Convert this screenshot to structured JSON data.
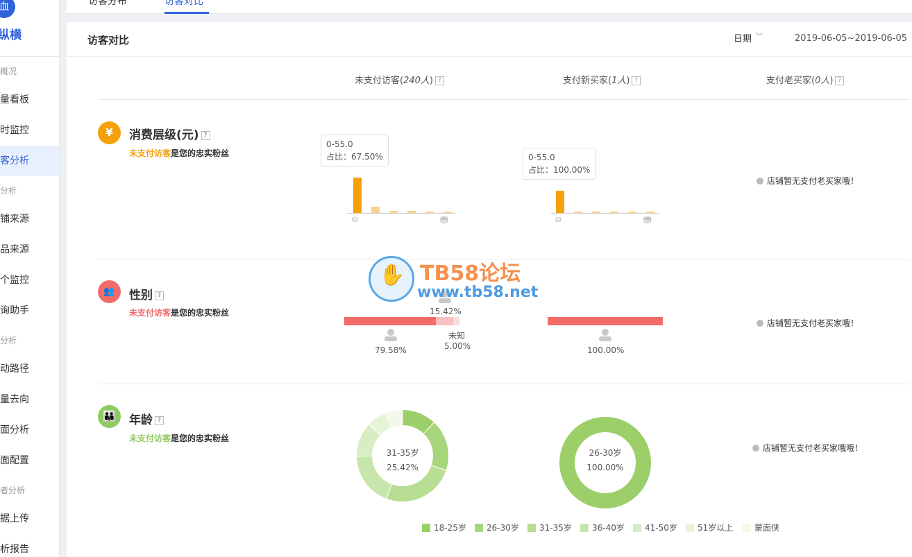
{
  "sidebar": {
    "logo_icon": "血",
    "logo_text": "量纵横",
    "groups": [
      "概况",
      "分析",
      "分析",
      "者分析"
    ],
    "items": [
      "量看板",
      "时监控",
      "客分析",
      "铺来源",
      "品来源",
      "个监控",
      "询助手",
      "动路径",
      "量去向",
      "面分析",
      "面配置",
      "据上传",
      "析报告"
    ]
  },
  "tabs": [
    "访客分布",
    "访客对比"
  ],
  "panel": {
    "title": "访客对比",
    "date_label": "日期",
    "date_range": "2019-06-05~2019-06-05",
    "columns": [
      {
        "label": "未支付访客(",
        "count": "240人",
        "close": ")"
      },
      {
        "label": "支付新买家(",
        "count": "1人",
        "close": ")"
      },
      {
        "label": "支付老买家(",
        "count": "0人",
        "close": ")"
      }
    ],
    "help_glyph": "?"
  },
  "sections": {
    "spend": {
      "icon_glyph": "¥",
      "title": "消费层级(元)",
      "highlight": "未支付访客",
      "subtitle_rest": "是您的忠实粉丝",
      "tooltip1_range": "0-55.0",
      "tooltip1_share": "占比：67.50%",
      "tooltip2_range": "0-55.0",
      "tooltip2_share": "占比：100.00%",
      "no_data": "店铺暂无支付老买家哦！",
      "color": "#f5a10a"
    },
    "gender": {
      "title": "性别",
      "highlight": "未支付访客",
      "subtitle_rest": "是您的忠实粉丝",
      "unpaid": {
        "female_pct": "79.58%",
        "male_pct": "15.42%",
        "unknown_label": "未知",
        "unknown_pct": "5.00%"
      },
      "new_buyer": {
        "female_pct": "100.00%"
      },
      "no_data": "店铺暂无支付老买家哦！",
      "color": "#f26b6b"
    },
    "age": {
      "title": "年龄",
      "highlight": "未支付访客",
      "subtitle_rest": "是您的忠实粉丝",
      "donut1_label": "31-35岁",
      "donut1_pct": "25.42%",
      "donut2_label": "26-30岁",
      "donut2_pct": "100.00%",
      "no_data": "店铺暂无支付老买家哦哦！",
      "color": "#8fcb5e",
      "legend": [
        "18-25岁",
        "26-30岁",
        "31-35岁",
        "36-40岁",
        "41-50岁",
        "51岁以上",
        "蒙面侠"
      ],
      "legend_colors": [
        "#9ccf6a",
        "#a8d67d",
        "#b7de92",
        "#c7e6ab",
        "#d7edc3",
        "#e6f4da",
        "#f2f8ea"
      ]
    }
  },
  "chart_data": [
    {
      "type": "bar",
      "name": "消费层级 - 未支付访客",
      "values": [
        67.5,
        12,
        4.5,
        3.5,
        1.5,
        1
      ],
      "colors": [
        "#f5a10a",
        "#fbd28c",
        "#fbd28c",
        "#fbd28c",
        "#fbd28c",
        "#fbd28c"
      ],
      "ylim": [
        0,
        100
      ]
    },
    {
      "type": "bar",
      "name": "消费层级 - 支付新买家",
      "values": [
        100,
        0.5,
        0.5,
        0.5,
        0.5,
        0.5
      ],
      "colors": [
        "#f5a10a",
        "#fbd28c",
        "#fbd28c",
        "#fbd28c",
        "#fbd28c",
        "#fbd28c"
      ],
      "ylim": [
        0,
        100
      ]
    },
    {
      "type": "pie",
      "name": "年龄 - 未支付访客",
      "categories": [
        "18-25岁",
        "26-30岁",
        "31-35岁",
        "36-40岁",
        "41-50岁",
        "51岁以上",
        "蒙面侠"
      ],
      "values": [
        12,
        18,
        25.42,
        19,
        12,
        7,
        6
      ]
    },
    {
      "type": "pie",
      "name": "年龄 - 支付新买家",
      "categories": [
        "26-30岁"
      ],
      "values": [
        100
      ]
    }
  ],
  "watermark": {
    "title": "TB58论坛",
    "url": "www.tb58.net"
  }
}
